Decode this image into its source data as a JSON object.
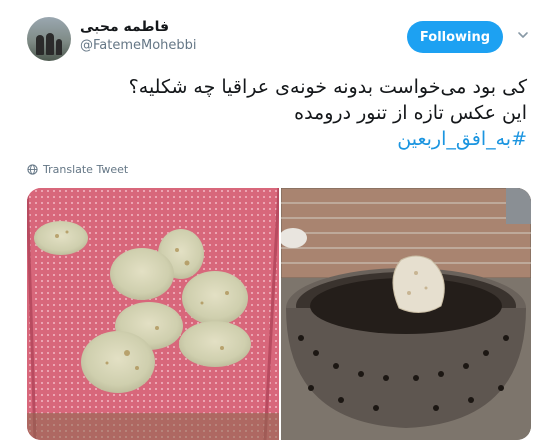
{
  "author": {
    "name": "فاطمه محبی",
    "handle": "@FatemeMohebbi"
  },
  "follow_button": {
    "label": "Following"
  },
  "tweet": {
    "line1": "کی بود می‌خواست بدونه خونه‌ی عراقیا چه شکلیه؟",
    "line2": "این عکس تازه از تنور درومده",
    "hashtag": "#به_افق_اربعین"
  },
  "translate_link": {
    "label": "Translate Tweet"
  },
  "icons": {
    "menu": "chevron-down-icon",
    "translate": "globe-icon"
  },
  "colors": {
    "accent": "#1da1f2",
    "hashtag": "#1b95e0",
    "secondary_text": "#657786"
  },
  "media": [
    {
      "name": "bread-on-pink-cloth-photo"
    },
    {
      "name": "tandoor-oven-photo"
    }
  ]
}
